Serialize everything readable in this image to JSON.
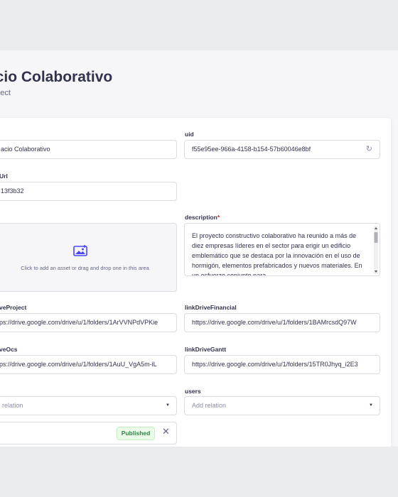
{
  "header": {
    "title": "acio Colaborativo",
    "subtitle": "roject"
  },
  "fields": {
    "name": {
      "value": "acio Colaborativo"
    },
    "uid": {
      "label": "uid",
      "value": "f55e95ee-966a-4158-b154-57b60046e8bf"
    },
    "url": {
      "label": "Url",
      "value": "13f3b32"
    },
    "media": {
      "text": "Click to add an asset or drag and drop one in this area"
    },
    "description": {
      "label": "description",
      "required_mark": "*",
      "value": "El proyecto constructivo colaborativo ha reunido a más de diez empresas líderes en el sector para erigir un edificio emblemático que se destaca por la innovación en el uso de hormigón, elementos prefabricados y nuevos materiales. En un esfuerzo conjunto para"
    },
    "linkDriveProject": {
      "label": "veProject",
      "value": "https://drive.google.com/drive/u/1/folders/1ArVVNPdVPKie"
    },
    "linkDriveFinancial": {
      "label": "linkDriveFinancial",
      "value": "https://drive.google.com/drive/u/1/folders/1BAMrcsdQ97W"
    },
    "linkDriveOcs": {
      "label": "veOcs",
      "value": "https://drive.google.com/drive/u/1/folders/1AuU_VgA5m-iL"
    },
    "linkDriveGantt": {
      "label": "linkDriveGantt",
      "value": "https://drive.google.com/drive/u/1/folders/15TR0Jhyq_i2E3"
    },
    "relation_left": {
      "placeholder": "relation"
    },
    "users": {
      "label": "users",
      "placeholder": "Add relation"
    },
    "status": {
      "badge": "Published",
      "close": "✕"
    }
  },
  "icons": {
    "refresh": "↻",
    "caret": "▼",
    "image": "image-icon"
  },
  "colors": {
    "accent": "#4945ff",
    "success": "#328048",
    "required": "#d02b20"
  }
}
